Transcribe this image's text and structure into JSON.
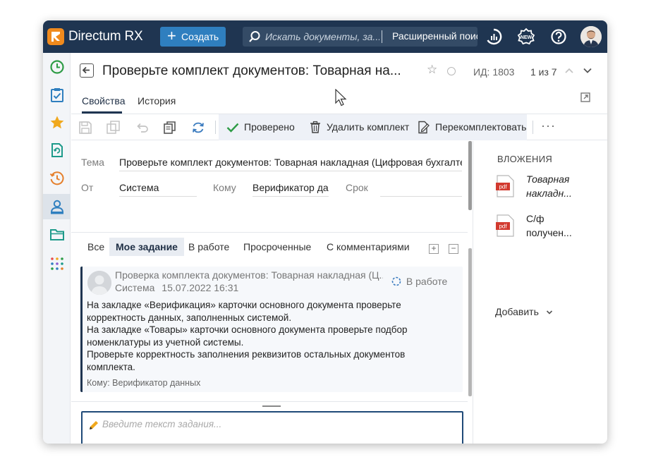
{
  "app": {
    "brand": "Directum RX",
    "accent": "#f08a1d",
    "topbar_color": "#1f3551"
  },
  "topbar": {
    "create_label": "Создать",
    "search_placeholder": "Искать документы, за...",
    "advanced_search_label": "Расширенный поис",
    "icons": [
      "activity-icon",
      "new-badge-icon",
      "help-icon",
      "user-avatar"
    ]
  },
  "leftnav": {
    "items": [
      "clock-icon",
      "tasks-icon",
      "favorites-star-icon",
      "document-cycle-icon",
      "history-icon",
      "user-card-icon",
      "folder-icon",
      "apps-grid-icon"
    ],
    "active": "user-card-icon"
  },
  "header": {
    "title": "Проверьте комплект документов: Товарная на...",
    "id_label": "ИД: 1803",
    "pager": "1 из 7"
  },
  "tabs": [
    {
      "label": "Свойства",
      "active": true
    },
    {
      "label": "История",
      "active": false
    }
  ],
  "toolbar": {
    "actions": {
      "verified": "Проверено",
      "delete_set": "Удалить комплект",
      "reassemble": "Перекомплектовать"
    },
    "more": "···"
  },
  "form": {
    "subject_label": "Тема",
    "subject_value": "Проверьте комплект документов: Товарная накладная (Цифровая бухгалтер",
    "from_label": "От",
    "from_value": "Система",
    "to_label": "Кому",
    "to_value": "Верификатор даı",
    "deadline_label": "Срок",
    "deadline_value": ""
  },
  "attachments": {
    "title": "ВЛОЖЕНИЯ",
    "items": [
      {
        "line1": "Товарная",
        "line2": "накладн...",
        "italic": true
      },
      {
        "line1": "С/ф",
        "line2": "получен...",
        "italic": false
      }
    ],
    "add_label": "Добавить"
  },
  "filters": {
    "items": [
      "Все",
      "Мое задание",
      "В работе",
      "Просроченные",
      "С комментариями"
    ],
    "active": "Мое задание",
    "expand": "+",
    "collapse": "−"
  },
  "task_card": {
    "title": "Проверка комплекта документов: Товарная накладная (Ц...",
    "author": "Система",
    "date": "15.07.2022 16:31",
    "status": "В работе",
    "body": "На закладке «Верификация» карточки основного документа проверьте корректность данных, заполненных системой.\nНа закладке «Товары» карточки основного документа проверьте подбор номенклатуры из учетной системы.\nПроверьте корректность заполнения реквизитов остальных документов комплекта.",
    "body_lines": [
      "На закладке «Верификация» карточки основного документа проверьте",
      "корректность данных, заполненных системой.",
      "На закладке «Товары» карточки основного документа проверьте подбор",
      "номенклатуры из учетной системы.",
      "Проверьте корректность заполнения реквизитов остальных документов",
      "комплекта."
    ],
    "to_line": "Кому: Верификатор данных"
  },
  "composer": {
    "placeholder": "Введите текст задания..."
  }
}
